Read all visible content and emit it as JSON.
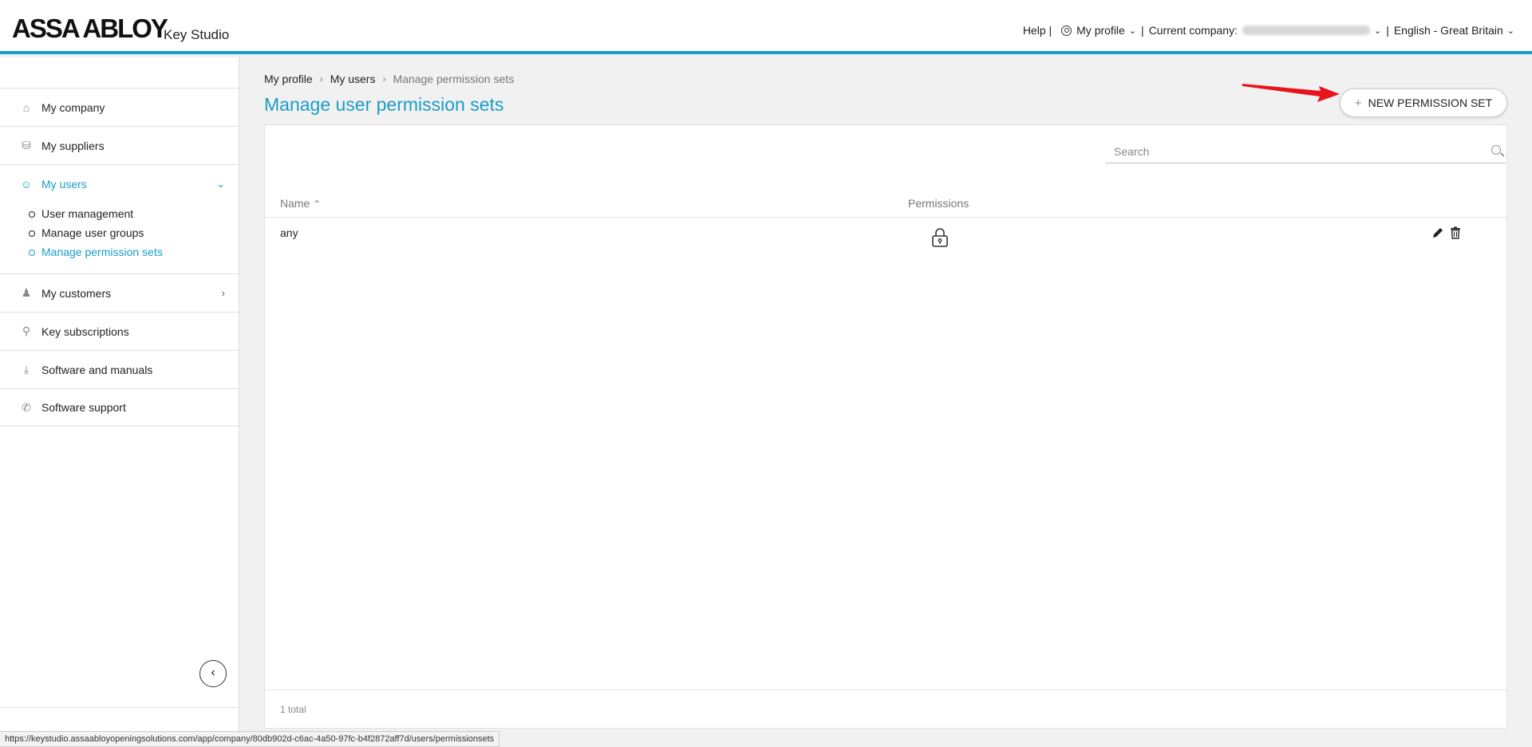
{
  "header": {
    "brand": "ASSA ABLOY",
    "product": "Key Studio",
    "help": "Help |",
    "my_profile": "My profile",
    "current_company_label": "Current company:",
    "language": "English - Great Britain"
  },
  "sidebar": {
    "items": [
      {
        "label": "My company",
        "icon": "home-icon"
      },
      {
        "label": "My suppliers",
        "icon": "truck-icon"
      },
      {
        "label": "My users",
        "icon": "user-icon"
      },
      {
        "label": "My customers",
        "icon": "customers-icon"
      },
      {
        "label": "Key subscriptions",
        "icon": "key-icon"
      },
      {
        "label": "Software and manuals",
        "icon": "download-icon"
      },
      {
        "label": "Software support",
        "icon": "phone-icon"
      }
    ],
    "subitems": [
      {
        "label": "User management"
      },
      {
        "label": "Manage user groups"
      },
      {
        "label": "Manage permission sets"
      }
    ]
  },
  "breadcrumb": [
    "My profile",
    "My users",
    "Manage permission sets"
  ],
  "page_title": "Manage user permission sets",
  "new_button_label": "NEW PERMISSION SET",
  "search": {
    "placeholder": "Search"
  },
  "table": {
    "columns": [
      "Name",
      "Permissions"
    ],
    "rows": [
      {
        "name": "any"
      }
    ],
    "total": "1 total"
  },
  "status_url": "https://keystudio.assaabloyopeningsolutions.com/app/company/80db902d-c6ac-4a50-97fc-b4f2872aff7d/users/permissionsets",
  "colors": {
    "accent": "#1a9dc8",
    "annotation_arrow": "#e8141b"
  }
}
